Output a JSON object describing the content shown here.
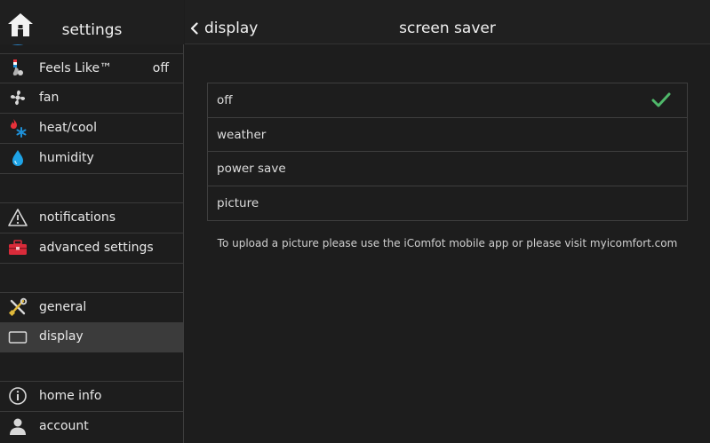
{
  "sidebar": {
    "title": "settings",
    "items": [
      {
        "label": "Feels Like™",
        "value": "off"
      },
      {
        "label": "fan"
      },
      {
        "label": "heat/cool"
      },
      {
        "label": "humidity"
      },
      {
        "label": "notifications"
      },
      {
        "label": "advanced settings"
      },
      {
        "label": "general"
      },
      {
        "label": "display"
      },
      {
        "label": "home info"
      },
      {
        "label": "account"
      }
    ],
    "active_item": "display"
  },
  "header": {
    "back_label": "display",
    "title": "screen saver"
  },
  "options": [
    {
      "label": "off",
      "selected": true
    },
    {
      "label": "weather",
      "selected": false
    },
    {
      "label": "power save",
      "selected": false
    },
    {
      "label": "picture",
      "selected": false
    }
  ],
  "note": "To upload a picture please use the iComfot mobile app or please visit myicomfort.com",
  "colors": {
    "background": "#1d1d1d",
    "active_row": "#3b3b3b",
    "check": "#4fb86a",
    "flame": "#e8313a",
    "snowflake": "#1e8fd6",
    "humidity_drop": "#1ea3e6",
    "toolbox": "#d92b3a"
  }
}
